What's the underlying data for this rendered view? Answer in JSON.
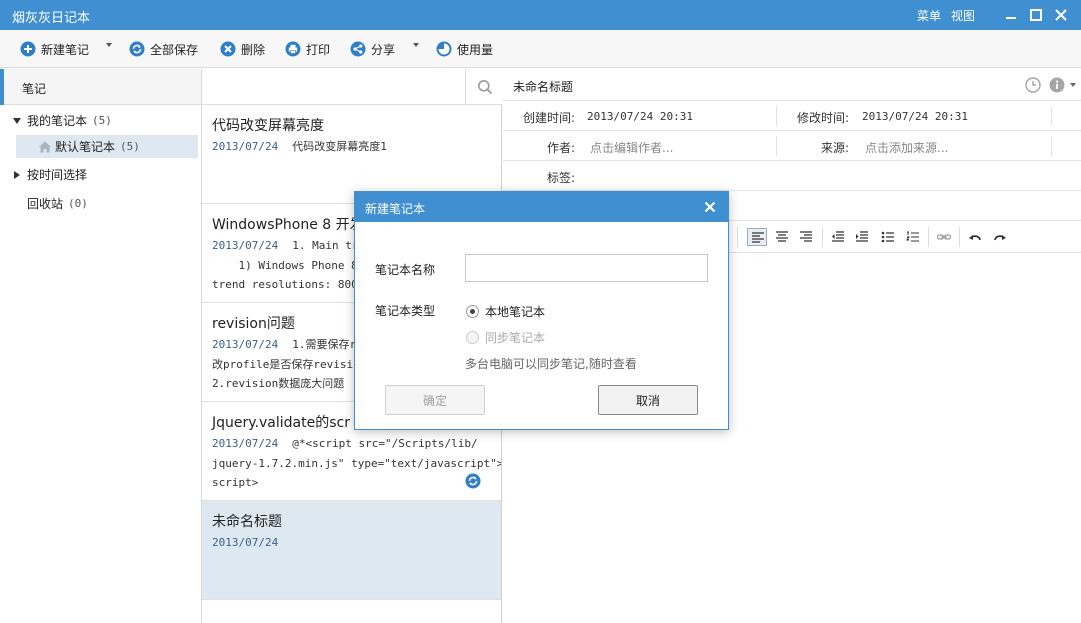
{
  "window": {
    "title": "烟灰灰日记本",
    "menu_label": "菜单",
    "view_label": "视图"
  },
  "toolbar": {
    "new_note": "新建笔记",
    "save_all": "全部保存",
    "delete": "删除",
    "print": "打印",
    "share": "分享",
    "usage": "使用量"
  },
  "sidebar": {
    "header": "笔记",
    "my_notebooks": "我的笔记本",
    "my_notebooks_count": "(5)",
    "default_notebook": "默认笔记本",
    "default_notebook_count": "(5)",
    "by_time": "按时间选择",
    "recycle": "回收站",
    "recycle_count": "(0)"
  },
  "search": {
    "placeholder": ""
  },
  "notes": [
    {
      "title": "代码改变屏幕亮度",
      "date": "2013/07/24",
      "lines": [
        "代码改变屏幕亮度1"
      ]
    },
    {
      "title": "WindowsPhone 8 开发",
      "date": "2013/07/24",
      "lines": [
        "1. Main tre",
        "    1) Windows Phone 8 c",
        "trend resolutions: 800 x"
      ]
    },
    {
      "title": "revision问题",
      "date": "2013/07/24",
      "lines": [
        "1.需要保存r",
        "改profile是否保存revisio",
        "2.revision数据庞大问题"
      ]
    },
    {
      "title": "Jquery.validate的scr",
      "date": "2013/07/24",
      "lines": [
        "@*<script src=\"/Scripts/lib/",
        "jquery-1.7.2.min.js\" type=\"text/javascript\"></",
        "script>"
      ]
    },
    {
      "title": "未命名标题",
      "date": "2013/07/24",
      "lines": []
    }
  ],
  "editor": {
    "title": "未命名标题",
    "created_label": "创建时间:",
    "created_value": "2013/07/24 20:31",
    "modified_label": "修改时间:",
    "modified_value": "2013/07/24 20:31",
    "author_label": "作者:",
    "author_placeholder": "点击编辑作者...",
    "source_label": "来源:",
    "source_placeholder": "点击添加来源...",
    "tags_label": "标签:"
  },
  "dialog": {
    "title": "新建笔记本",
    "name_label": "笔记本名称",
    "name_value": "",
    "type_label": "笔记本类型",
    "option_local": "本地笔记本",
    "option_sync": "同步笔记本",
    "hint": "多台电脑可以同步笔记,随时查看",
    "ok": "确定",
    "cancel": "取消"
  },
  "colors": {
    "accent": "#3f8fd1",
    "selected_note": "#dee8f1",
    "date_text": "#3a5f8a"
  },
  "icons": [
    "plus-circle-icon",
    "sync-icon",
    "delete-icon",
    "print-icon",
    "share-icon",
    "pie-chart-icon",
    "search-icon",
    "clock-icon",
    "info-icon",
    "home-icon",
    "close-icon"
  ]
}
